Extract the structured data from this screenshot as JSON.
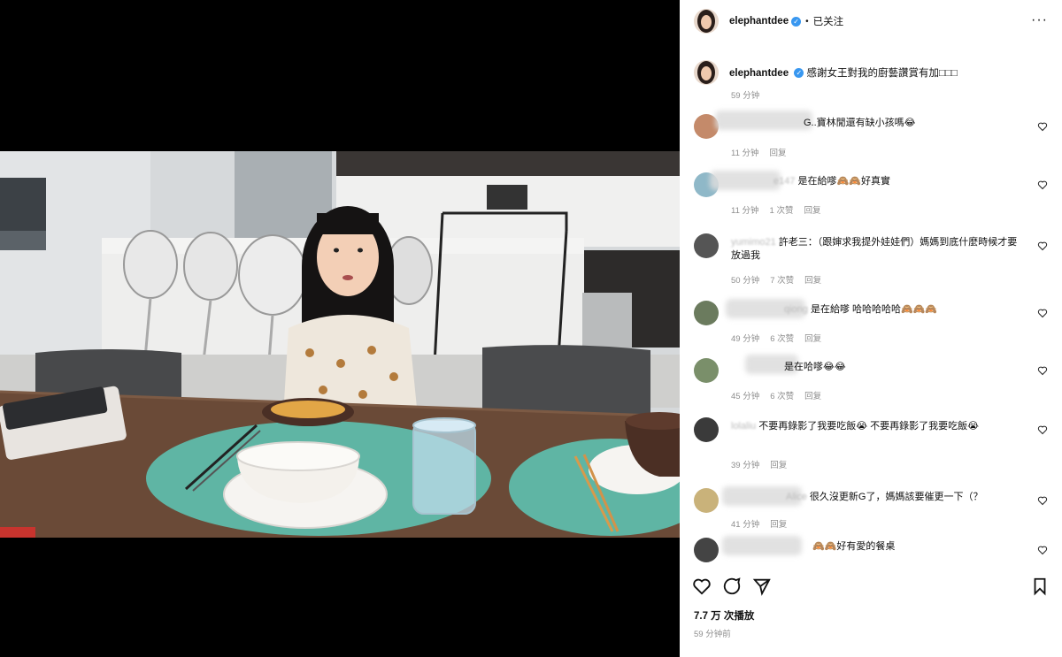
{
  "post": {
    "username": "elephantdee",
    "separator": "•",
    "follow_label": "已关注",
    "more": "···",
    "caption_user": "elephantdee",
    "caption_text": "感謝女王對我的廚藝讚賞有加□□□",
    "caption_time": "59 分钟"
  },
  "comments": [
    {
      "user": "",
      "text": "G..寶林閒還有缺小孩嗎😂",
      "meta": [
        "11 分钟",
        "回复"
      ]
    },
    {
      "user": "e147",
      "text": "是在給嗲🙈🙈好真實",
      "meta": [
        "11 分钟",
        "1 次赞",
        "回复"
      ]
    },
    {
      "user": "yumimo21",
      "text": "許老三：（跟婶求我提外娃娃們）媽媽到底什麼時候才要放過我",
      "meta": [
        "50 分钟",
        "7 次赞",
        "回复"
      ]
    },
    {
      "user": "qiong",
      "text": "是在給嗲 哈哈哈哈哈🙈🙈🙈",
      "meta": [
        "49 分钟",
        "6 次赞",
        "回复"
      ]
    },
    {
      "user": "",
      "text": "是在哈嗲😂😂",
      "meta": [
        "45 分钟",
        "6 次赞",
        "回复"
      ]
    },
    {
      "user": "lolaliu",
      "text": "不要再錄影了我要吃飯😭 不要再錄影了我要吃飯😭",
      "meta": [
        "39 分钟",
        "回复"
      ]
    },
    {
      "user": "Alice",
      "text": "很久沒更新G了，媽媽該要催更一下（？",
      "meta": [
        "41 分钟",
        "回复"
      ]
    },
    {
      "user": "",
      "text": "🙈🙈好有愛的餐桌",
      "meta": []
    }
  ],
  "footer": {
    "views": "7.7 万 次播放",
    "time": "59 分钟前"
  },
  "icons": {
    "like": "heart-icon",
    "comment": "comment-icon",
    "share": "share-icon",
    "save": "bookmark-icon",
    "verified": "verified-badge-icon"
  },
  "colors": {
    "verified": "#3897f0",
    "meta": "#8e8e8e",
    "placemat": "#5fb5a4"
  }
}
